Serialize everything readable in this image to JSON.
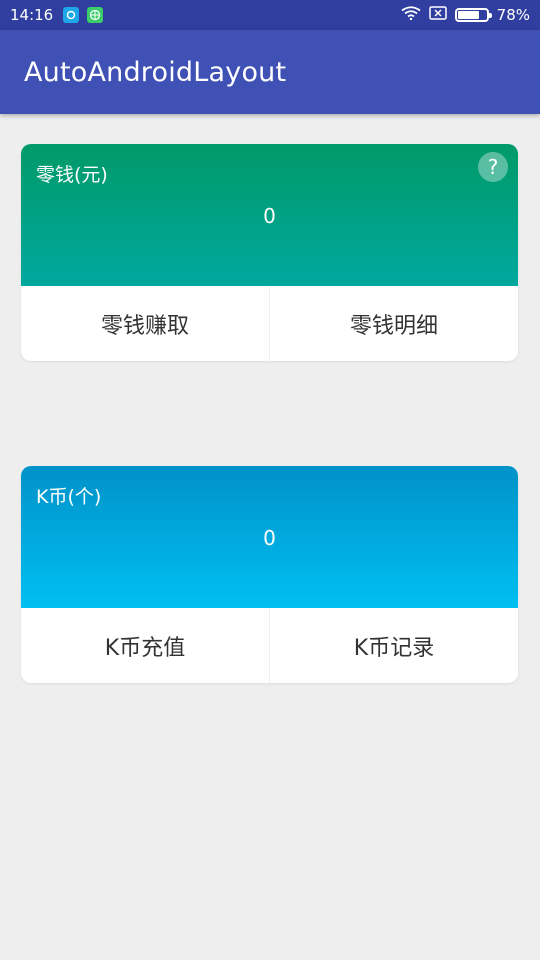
{
  "status_bar": {
    "time": "14:16",
    "battery": "78%",
    "battery_level": 0.78,
    "icons": [
      "app-notification-icon",
      "browser-notification-icon",
      "wifi-icon",
      "sim-x-icon",
      "battery-icon"
    ]
  },
  "app_bar": {
    "title": "AutoAndroidLayout"
  },
  "wallet_card": {
    "label": "零钱(元)",
    "value": "0",
    "help": "?",
    "earn_label": "零钱赚取",
    "detail_label": "零钱明细"
  },
  "kcoin_card": {
    "label": "K币(个)",
    "value": "0",
    "recharge_label": "K币充值",
    "record_label": "K币记录"
  },
  "colors": {
    "status_bar": "#303f9f",
    "app_bar": "#3f51b5",
    "wallet_top": "#009a68",
    "wallet_bottom": "#00a89e",
    "kcoin_top": "#0092c8",
    "kcoin_bottom": "#00bff2",
    "background": "#eeeeee"
  }
}
